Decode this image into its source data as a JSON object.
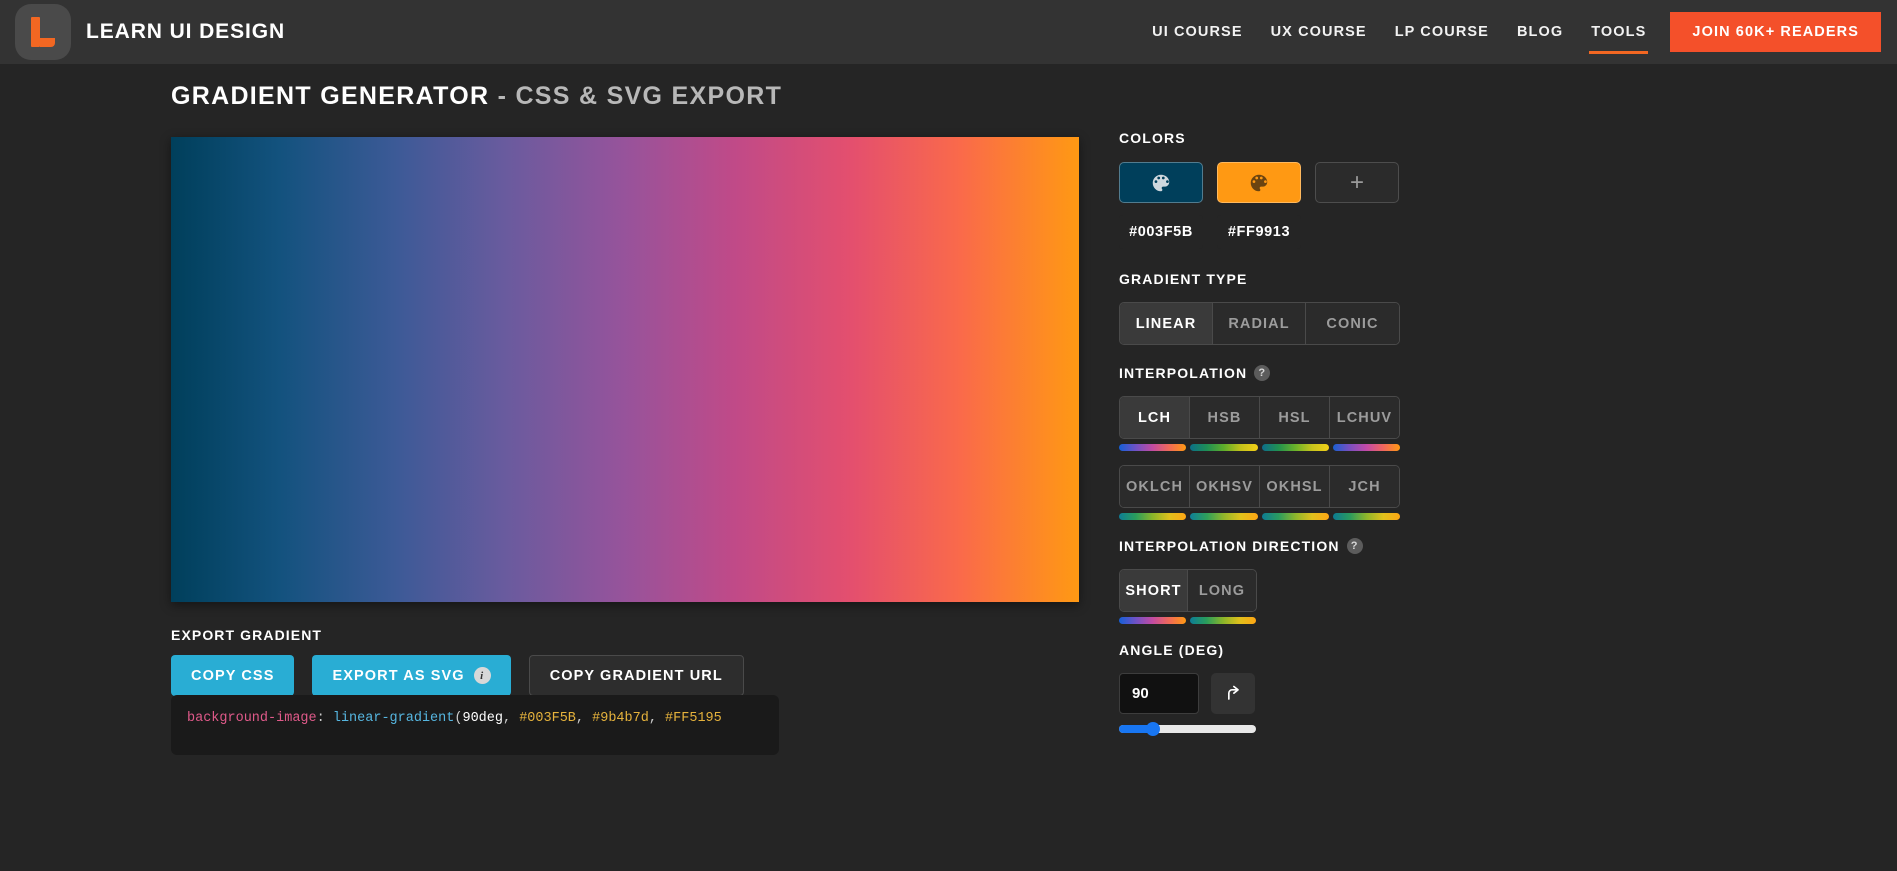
{
  "header": {
    "logo_icon": "learn-ui-design-logo",
    "brand": "LEARN UI DESIGN",
    "nav": [
      {
        "label": "UI COURSE",
        "active": false
      },
      {
        "label": "UX COURSE",
        "active": false
      },
      {
        "label": "LP COURSE",
        "active": false
      },
      {
        "label": "BLOG",
        "active": false
      },
      {
        "label": "TOOLS",
        "active": true
      }
    ],
    "cta": "JOIN 60K+ READERS"
  },
  "page": {
    "title_main": "GRADIENT GENERATOR",
    "title_sub": "- CSS & SVG EXPORT"
  },
  "preview": {
    "gradient_css": "linear-gradient(90deg, #003F5B 0%, #13527e 12%, #3d5a97 25%, #6a5b9e 37%, #97539b 50%, #c04a88 62%, #e44f6e 75%, #fa6a4a 87%, #FF9913 100%)"
  },
  "export": {
    "label": "EXPORT GRADIENT",
    "copy_css": "COPY CSS",
    "export_svg": "EXPORT AS SVG",
    "svg_info_icon": "info-icon",
    "copy_url": "COPY GRADIENT URL",
    "code": {
      "property": "background-image",
      "colon": ":",
      "function": "linear-gradient",
      "open_paren": "(",
      "angle": "90deg",
      "comma1": ", ",
      "stop1": "#003F5B",
      "comma2": ", ",
      "stop2": "#9b4b7d",
      "comma3": ", ",
      "stop3": "#FF5195"
    }
  },
  "sidebar": {
    "colors": {
      "label": "COLORS",
      "swatches": [
        {
          "hex": "#003F5B",
          "icon": "palette-icon"
        },
        {
          "hex": "#FF9913",
          "icon": "palette-icon"
        }
      ],
      "add_label": "+"
    },
    "gradient_type": {
      "label": "GRADIENT TYPE",
      "options": [
        {
          "label": "LINEAR",
          "active": true
        },
        {
          "label": "RADIAL",
          "active": false
        },
        {
          "label": "CONIC",
          "active": false
        }
      ]
    },
    "interpolation": {
      "label": "INTERPOLATION",
      "help_icon": "question-mark-icon",
      "row1": [
        {
          "label": "LCH",
          "active": true,
          "preview": "linear-gradient(90deg,#1560d8,#6f52c6,#c24ba2,#f06a58,#ff9913)"
        },
        {
          "label": "HSB",
          "active": false,
          "preview": "linear-gradient(90deg,#0b6f88,#1f8f55,#5fae2a,#c5c21a,#f4cf17)"
        },
        {
          "label": "HSL",
          "active": false,
          "preview": "linear-gradient(90deg,#0d6d8c,#22924f,#6bb32a,#c8c41c,#f2d018)"
        },
        {
          "label": "LCHUV",
          "active": false,
          "preview": "linear-gradient(90deg,#1a5fd0,#7a4fc0,#c24aa8,#f0665e,#ff9913)"
        }
      ],
      "row2": [
        {
          "label": "OKLCH",
          "active": false,
          "preview": "linear-gradient(90deg,#0d7d96,#2a9d5c,#8ab52a,#dfc01c,#ffa614)"
        },
        {
          "label": "OKHSV",
          "active": false,
          "preview": "linear-gradient(90deg,#0e7f98,#2fa05a,#93b72a,#e2c21b,#ffa614)"
        },
        {
          "label": "OKHSL",
          "active": false,
          "preview": "linear-gradient(90deg,#0d7b94,#2b9b5e,#8eb62c,#e0c01d,#ffa614)"
        },
        {
          "label": "JCH",
          "active": false,
          "preview": "linear-gradient(90deg,#0c7a92,#2a9a5e,#8fb62b,#e1c11c,#ffa614)"
        }
      ]
    },
    "interpolation_direction": {
      "label": "INTERPOLATION DIRECTION",
      "help_icon": "question-mark-icon",
      "options": [
        {
          "label": "SHORT",
          "active": true,
          "preview": "linear-gradient(90deg,#1560d8,#6f52c6,#c24ba2,#f06a58,#ff9913)"
        },
        {
          "label": "LONG",
          "active": false,
          "preview": "linear-gradient(90deg,#0d7d96,#2a9d5c,#8ab52a,#dfc01c,#ffa614)"
        }
      ]
    },
    "angle": {
      "label": "ANGLE (DEG)",
      "value": "90",
      "placeholder": "90",
      "rotate_icon": "rotate-arrow-icon",
      "slider_percent": 25
    }
  },
  "colors": {
    "page_bg": "#252525",
    "header_bg": "#333333",
    "accent_orange": "#F26722",
    "cta_orange": "#F4502A",
    "accent_blue": "#29ADD4",
    "slider_blue": "#1876f2"
  }
}
